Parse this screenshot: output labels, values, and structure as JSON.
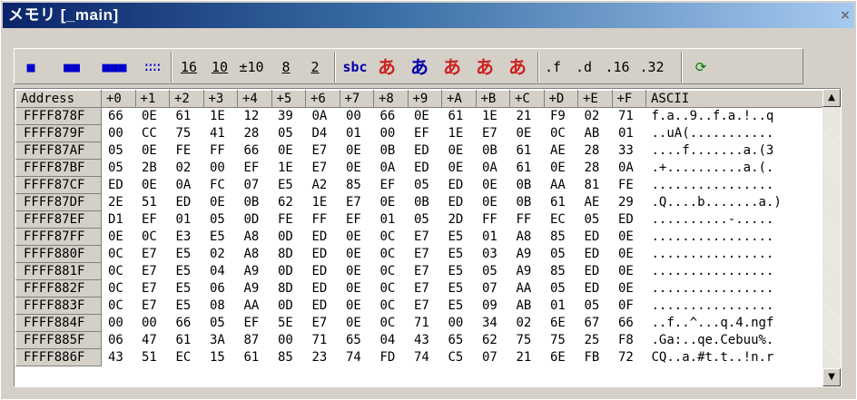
{
  "window": {
    "title": "メモリ [_main]",
    "close_glyph": "×"
  },
  "toolbar": {
    "buttons": [
      {
        "label": "■",
        "name": "size-1-button",
        "color": "#0000cc"
      },
      {
        "label": "■■",
        "name": "size-2-button",
        "color": "#0000cc"
      },
      {
        "label": "■■■",
        "name": "size-4-button",
        "color": "#0000cc"
      },
      {
        "label": "∷∷",
        "name": "size-8-button",
        "color": "#0000cc"
      },
      {
        "label": "16",
        "name": "radix-16-button"
      },
      {
        "label": "10",
        "name": "radix-10-button"
      },
      {
        "label": "±10",
        "name": "signed-10-button"
      },
      {
        "label": "8",
        "name": "radix-8-button"
      },
      {
        "label": "2",
        "name": "radix-2-button"
      },
      {
        "label": "sbc",
        "name": "sbc-button",
        "color": "#0000aa"
      },
      {
        "label": "あ",
        "name": "kana-button-1",
        "color": "#cc2222"
      },
      {
        "label": "あ",
        "name": "kana-button-2",
        "color": "#0000aa"
      },
      {
        "label": "あ",
        "name": "kana-button-3",
        "color": "#cc2222"
      },
      {
        "label": "あ",
        "name": "kana-button-4",
        "color": "#cc2222"
      },
      {
        "label": "あ",
        "name": "kana-button-5",
        "color": "#cc2222"
      },
      {
        "label": ".f",
        "name": "float-button"
      },
      {
        "label": ".d",
        "name": "double-button"
      },
      {
        "label": ".16",
        "name": "fixed16-button"
      },
      {
        "label": ".32",
        "name": "fixed32-button"
      },
      {
        "label": "⟳",
        "name": "refresh-button",
        "color": "#007f00"
      }
    ]
  },
  "grid": {
    "headers": [
      "Address",
      "+0",
      "+1",
      "+2",
      "+3",
      "+4",
      "+5",
      "+6",
      "+7",
      "+8",
      "+9",
      "+A",
      "+B",
      "+C",
      "+D",
      "+E",
      "+F",
      "ASCII"
    ],
    "rows": [
      {
        "addr": "FFFF878F",
        "bytes": [
          "66",
          "0E",
          "61",
          "1E",
          "12",
          "39",
          "0A",
          "00",
          "66",
          "0E",
          "61",
          "1E",
          "21",
          "F9",
          "02",
          "71"
        ],
        "ascii": "f.a..9..f.a.!..q"
      },
      {
        "addr": "FFFF879F",
        "bytes": [
          "00",
          "CC",
          "75",
          "41",
          "28",
          "05",
          "D4",
          "01",
          "00",
          "EF",
          "1E",
          "E7",
          "0E",
          "0C",
          "AB",
          "01"
        ],
        "ascii": "..uA(..........."
      },
      {
        "addr": "FFFF87AF",
        "bytes": [
          "05",
          "0E",
          "FE",
          "FF",
          "66",
          "0E",
          "E7",
          "0E",
          "0B",
          "ED",
          "0E",
          "0B",
          "61",
          "AE",
          "28",
          "33"
        ],
        "ascii": "....f.......a.(3"
      },
      {
        "addr": "FFFF87BF",
        "bytes": [
          "05",
          "2B",
          "02",
          "00",
          "EF",
          "1E",
          "E7",
          "0E",
          "0A",
          "ED",
          "0E",
          "0A",
          "61",
          "0E",
          "28",
          "0A"
        ],
        "ascii": ".+..........a.(."
      },
      {
        "addr": "FFFF87CF",
        "bytes": [
          "ED",
          "0E",
          "0A",
          "FC",
          "07",
          "E5",
          "A2",
          "85",
          "EF",
          "05",
          "ED",
          "0E",
          "0B",
          "AA",
          "81",
          "FE"
        ],
        "ascii": "................"
      },
      {
        "addr": "FFFF87DF",
        "bytes": [
          "2E",
          "51",
          "ED",
          "0E",
          "0B",
          "62",
          "1E",
          "E7",
          "0E",
          "0B",
          "ED",
          "0E",
          "0B",
          "61",
          "AE",
          "29"
        ],
        "ascii": ".Q....b.......a.)"
      },
      {
        "addr": "FFFF87EF",
        "bytes": [
          "D1",
          "EF",
          "01",
          "05",
          "0D",
          "FE",
          "FF",
          "EF",
          "01",
          "05",
          "2D",
          "FF",
          "FF",
          "EC",
          "05",
          "ED"
        ],
        "ascii": "..........-....."
      },
      {
        "addr": "FFFF87FF",
        "bytes": [
          "0E",
          "0C",
          "E3",
          "E5",
          "A8",
          "0D",
          "ED",
          "0E",
          "0C",
          "E7",
          "E5",
          "01",
          "A8",
          "85",
          "ED",
          "0E"
        ],
        "ascii": "................"
      },
      {
        "addr": "FFFF880F",
        "bytes": [
          "0C",
          "E7",
          "E5",
          "02",
          "A8",
          "8D",
          "ED",
          "0E",
          "0C",
          "E7",
          "E5",
          "03",
          "A9",
          "05",
          "ED",
          "0E"
        ],
        "ascii": "................"
      },
      {
        "addr": "FFFF881F",
        "bytes": [
          "0C",
          "E7",
          "E5",
          "04",
          "A9",
          "0D",
          "ED",
          "0E",
          "0C",
          "E7",
          "E5",
          "05",
          "A9",
          "85",
          "ED",
          "0E"
        ],
        "ascii": "................"
      },
      {
        "addr": "FFFF882F",
        "bytes": [
          "0C",
          "E7",
          "E5",
          "06",
          "A9",
          "8D",
          "ED",
          "0E",
          "0C",
          "E7",
          "E5",
          "07",
          "AA",
          "05",
          "ED",
          "0E"
        ],
        "ascii": "................"
      },
      {
        "addr": "FFFF883F",
        "bytes": [
          "0C",
          "E7",
          "E5",
          "08",
          "AA",
          "0D",
          "ED",
          "0E",
          "0C",
          "E7",
          "E5",
          "09",
          "AB",
          "01",
          "05",
          "0F"
        ],
        "ascii": "................"
      },
      {
        "addr": "FFFF884F",
        "bytes": [
          "00",
          "00",
          "66",
          "05",
          "EF",
          "5E",
          "E7",
          "0E",
          "0C",
          "71",
          "00",
          "34",
          "02",
          "6E",
          "67",
          "66"
        ],
        "ascii": "..f..^...q.4.ngf"
      },
      {
        "addr": "FFFF885F",
        "bytes": [
          "06",
          "47",
          "61",
          "3A",
          "87",
          "00",
          "71",
          "65",
          "04",
          "43",
          "65",
          "62",
          "75",
          "75",
          "25",
          "F8"
        ],
        "ascii": ".Ga:..qe.Cebuu%."
      },
      {
        "addr": "FFFF886F",
        "bytes": [
          "43",
          "51",
          "EC",
          "15",
          "61",
          "85",
          "23",
          "74",
          "FD",
          "74",
          "C5",
          "07",
          "21",
          "6E",
          "FB",
          "72"
        ],
        "ascii": "CQ..a.#t.t..!n.r"
      }
    ]
  },
  "scrollbar": {
    "up_glyph": "▲",
    "down_glyph": "▼"
  }
}
